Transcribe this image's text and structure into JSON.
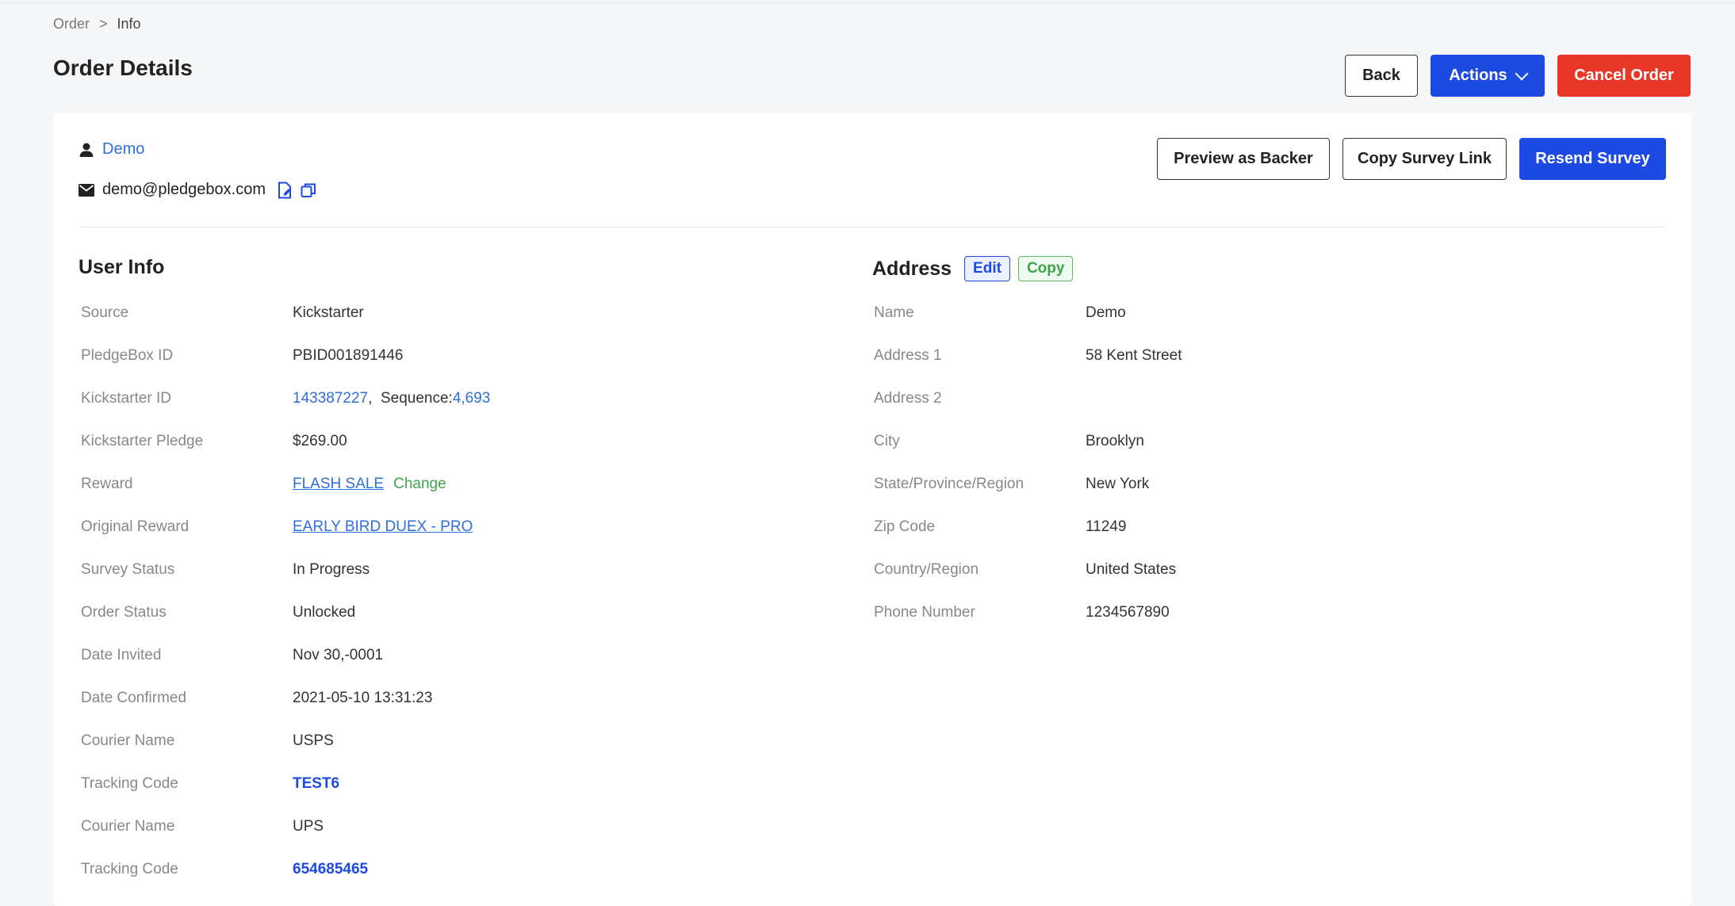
{
  "breadcrumb": {
    "parent": "Order",
    "separator": ">",
    "current": "Info"
  },
  "page": {
    "title": "Order Details"
  },
  "header_actions": {
    "back": "Back",
    "actions": "Actions",
    "cancel": "Cancel Order"
  },
  "user": {
    "name": "Demo",
    "email": "demo@pledgebox.com"
  },
  "card_actions": {
    "preview": "Preview as Backer",
    "copy_link": "Copy Survey Link",
    "resend": "Resend Survey"
  },
  "user_info": {
    "title": "User Info",
    "rows": [
      {
        "label": "Source",
        "value": "Kickstarter"
      },
      {
        "label": "PledgeBox ID",
        "value": "PBID001891446"
      },
      {
        "label": "Kickstarter ID",
        "value": "143387227",
        "sep": ",",
        "seq_label": "Sequence:",
        "seq_value": "4,693"
      },
      {
        "label": "Kickstarter Pledge",
        "value": "$269.00"
      },
      {
        "label": "Reward",
        "value": "FLASH SALE",
        "action": "Change"
      },
      {
        "label": "Original Reward",
        "value": "EARLY BIRD DUEX - PRO"
      },
      {
        "label": "Survey Status",
        "value": "In Progress"
      },
      {
        "label": "Order Status",
        "value": "Unlocked"
      },
      {
        "label": "Date Invited",
        "value": "Nov 30,-0001"
      },
      {
        "label": "Date Confirmed",
        "value": "2021-05-10 13:31:23"
      },
      {
        "label": "Courier Name",
        "value": "USPS"
      },
      {
        "label": "Tracking Code",
        "value": "TEST6"
      },
      {
        "label": "Courier Name",
        "value": "UPS"
      },
      {
        "label": "Tracking Code",
        "value": "654685465"
      }
    ]
  },
  "address": {
    "title": "Address",
    "edit": "Edit",
    "copy": "Copy",
    "rows": [
      {
        "label": "Name",
        "value": "Demo"
      },
      {
        "label": "Address 1",
        "value": "58 Kent Street"
      },
      {
        "label": "Address 2",
        "value": ""
      },
      {
        "label": "City",
        "value": "Brooklyn"
      },
      {
        "label": "State/Province/Region",
        "value": "New York"
      },
      {
        "label": "Zip Code",
        "value": "11249"
      },
      {
        "label": "Country/Region",
        "value": "United States"
      },
      {
        "label": "Phone Number",
        "value": "1234567890"
      }
    ]
  },
  "icons": {
    "user": "user-icon",
    "mail": "mail-icon",
    "edit_email": "edit-email-icon",
    "copy_email": "copy-email-icon",
    "chevron": "chevron-down-icon"
  },
  "colors": {
    "primary": "#1d4be2",
    "danger": "#e83628",
    "link": "#2f6fd8",
    "success": "#3fa34d"
  }
}
